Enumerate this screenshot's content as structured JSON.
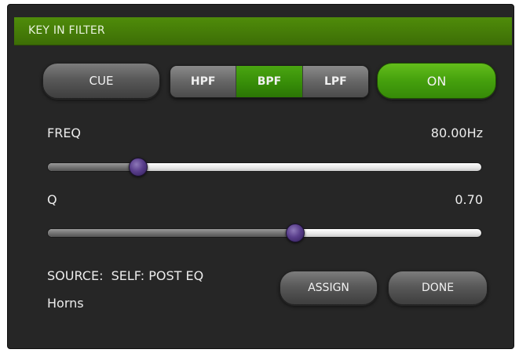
{
  "window": {
    "title": "KEY IN FILTER"
  },
  "buttons": {
    "cue": "CUE",
    "on": "ON",
    "assign": "ASSIGN",
    "done": "DONE"
  },
  "filter_types": [
    {
      "label": "HPF",
      "selected": false
    },
    {
      "label": "BPF",
      "selected": true
    },
    {
      "label": "LPF",
      "selected": false
    }
  ],
  "freq": {
    "label": "FREQ",
    "value": "80.00Hz",
    "slider_fraction": 0.21
  },
  "q": {
    "label": "Q",
    "value": "0.70",
    "slider_fraction": 0.57
  },
  "source": {
    "text": "SOURCE:  SELF: POST EQ",
    "channel": "Horns"
  },
  "colors": {
    "accent_green": "#45a00d",
    "panel_bg": "#262626",
    "knob": "#5a3f8c"
  }
}
